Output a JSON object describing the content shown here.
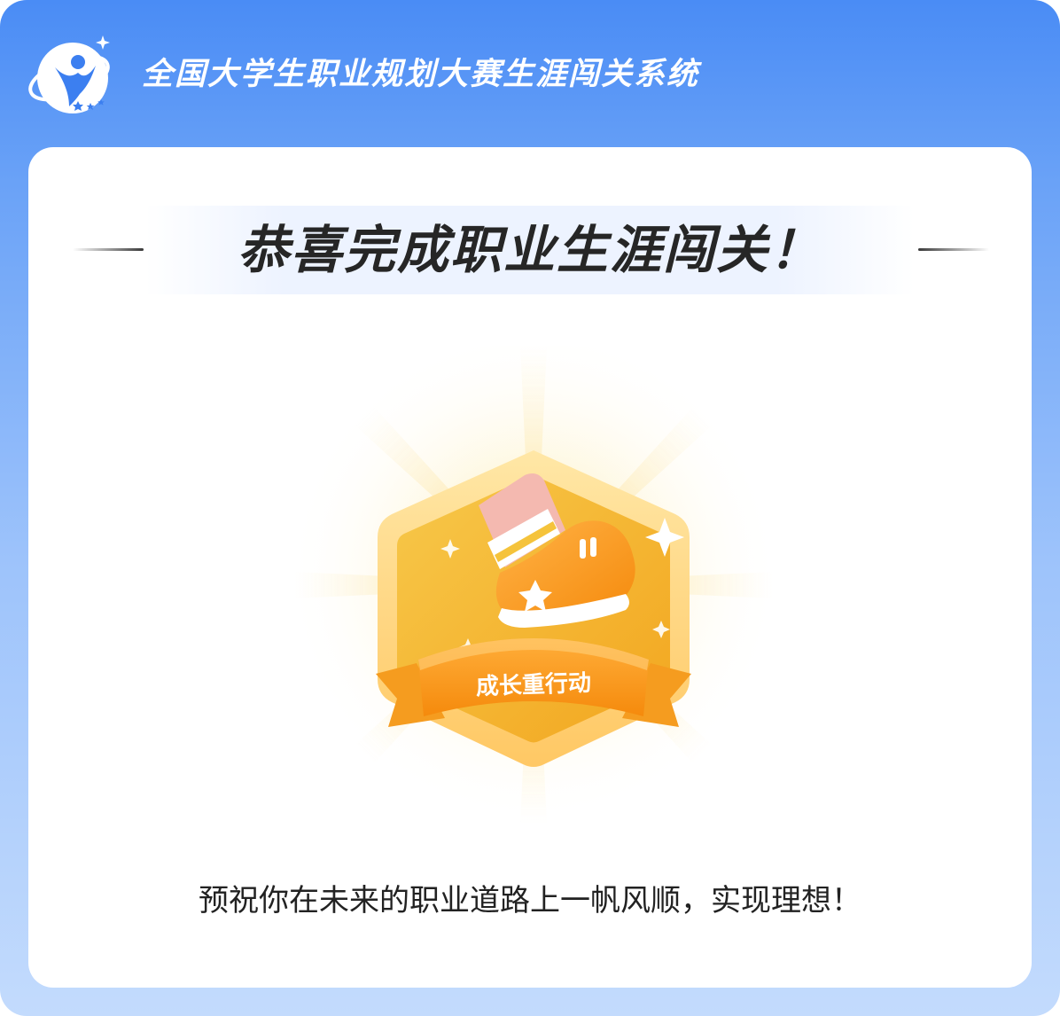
{
  "app": {
    "title": "全国大学生职业规划大赛生涯闯关系统",
    "logo_icon": "star-person-logo-icon"
  },
  "card": {
    "headline": "恭喜完成职业生涯闯关！",
    "badge": {
      "label": "成长重行动",
      "icon": "sneaker-badge-icon"
    },
    "message": "预祝你在未来的职业道路上一帆风顺，实现理想！"
  },
  "colors": {
    "header_blue": "#4a8cf5",
    "badge_orange": "#f7931e",
    "badge_gold": "#f5b731",
    "headline_text": "#262626"
  }
}
